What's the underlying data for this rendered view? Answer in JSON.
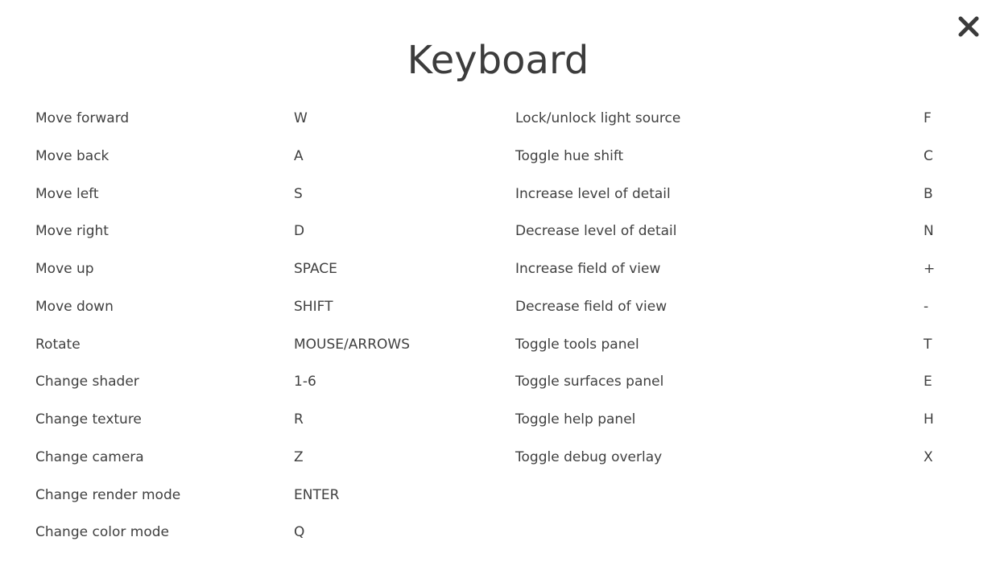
{
  "dialog": {
    "title": "Keyboard",
    "close_icon": "close-x-icon"
  },
  "left_shortcuts": [
    {
      "action": "Move forward",
      "key": "W"
    },
    {
      "action": "Move back",
      "key": "A"
    },
    {
      "action": "Move left",
      "key": "S"
    },
    {
      "action": "Move right",
      "key": "D"
    },
    {
      "action": "Move up",
      "key": "SPACE"
    },
    {
      "action": "Move down",
      "key": "SHIFT"
    },
    {
      "action": "Rotate",
      "key": "MOUSE/ARROWS"
    },
    {
      "action": "Change shader",
      "key": "1-6"
    },
    {
      "action": "Change texture",
      "key": "R"
    },
    {
      "action": "Change camera",
      "key": "Z"
    },
    {
      "action": "Change render mode",
      "key": "ENTER"
    },
    {
      "action": "Change color mode",
      "key": "Q"
    }
  ],
  "right_shortcuts": [
    {
      "action": "Lock/unlock light source",
      "key": "F"
    },
    {
      "action": "Toggle hue shift",
      "key": "C"
    },
    {
      "action": "Increase level of detail",
      "key": "B"
    },
    {
      "action": "Decrease level of detail",
      "key": "N"
    },
    {
      "action": "Increase field of view",
      "key": "+"
    },
    {
      "action": "Decrease field of view",
      "key": "-"
    },
    {
      "action": "Toggle tools panel",
      "key": "T"
    },
    {
      "action": "Toggle surfaces panel",
      "key": "E"
    },
    {
      "action": "Toggle help panel",
      "key": "H"
    },
    {
      "action": "Toggle debug overlay",
      "key": "X"
    }
  ]
}
